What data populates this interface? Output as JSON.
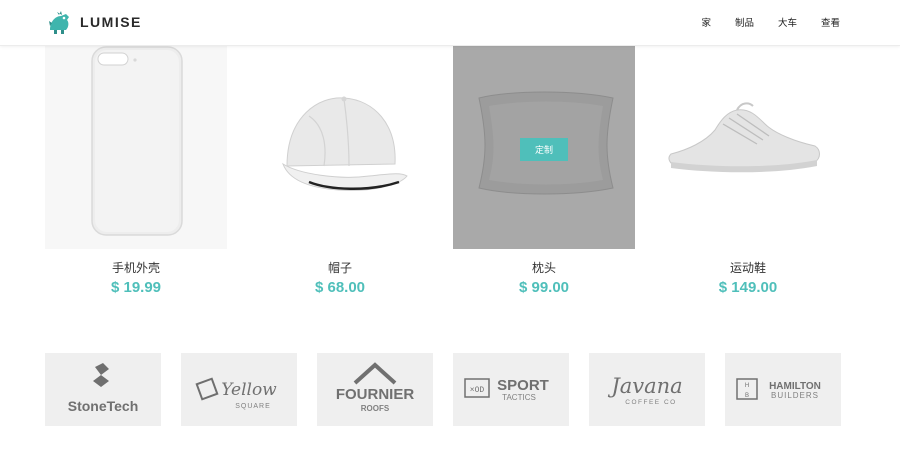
{
  "header": {
    "logo_text": "LUMISE",
    "nav": [
      {
        "label": "家"
      },
      {
        "label": "制品"
      },
      {
        "label": "大车"
      },
      {
        "label": "查看"
      }
    ]
  },
  "products": [
    {
      "name": "手机外壳",
      "price": "$ 19.99",
      "image": "phone-case-icon"
    },
    {
      "name": "帽子",
      "price": "$ 68.00",
      "image": "cap-icon"
    },
    {
      "name": "枕头",
      "price": "$ 99.00",
      "image": "pillow-icon",
      "overlay_button": "定制"
    },
    {
      "name": "运动鞋",
      "price": "$ 149.00",
      "image": "sneaker-icon"
    }
  ],
  "brands": [
    {
      "name": "StoneTech"
    },
    {
      "name": "Yellow",
      "sub": "SQUARE"
    },
    {
      "name": "FOURNIER",
      "sub": "ROOFS"
    },
    {
      "name": "SPORT",
      "sub": "TACTICS"
    },
    {
      "name": "Javana",
      "sub": "COFFEE CO"
    },
    {
      "name": "HAMILTON",
      "sub": "BUILDERS"
    }
  ],
  "colors": {
    "accent": "#4fbfba",
    "logo_brand": "#3fb5ad",
    "overlay": "#a9a9a9",
    "brand_bg": "#efefef"
  }
}
